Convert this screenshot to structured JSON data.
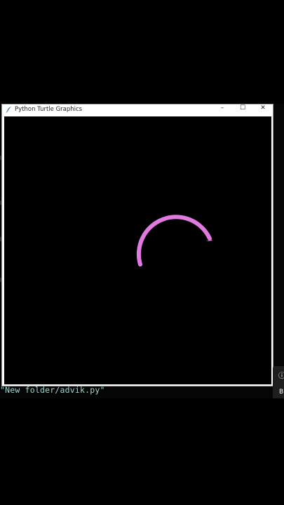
{
  "window": {
    "title": "Python Turtle Graphics",
    "minimize_glyph": "–",
    "maximize_glyph": "☐",
    "close_glyph": "✕",
    "icon": "feather-icon"
  },
  "canvas": {
    "background": "#000000",
    "pen_color": "#e07ae0",
    "turtle_cursor": "arrow-cursor-icon"
  },
  "terminal": {
    "path_text": "\"New folder/advik.py\""
  },
  "side_panel": {
    "glyph": "ⓘ",
    "letter": "B"
  },
  "colors": {
    "terminal_text": "#9fd7cf",
    "window_frame": "#ffffff"
  }
}
